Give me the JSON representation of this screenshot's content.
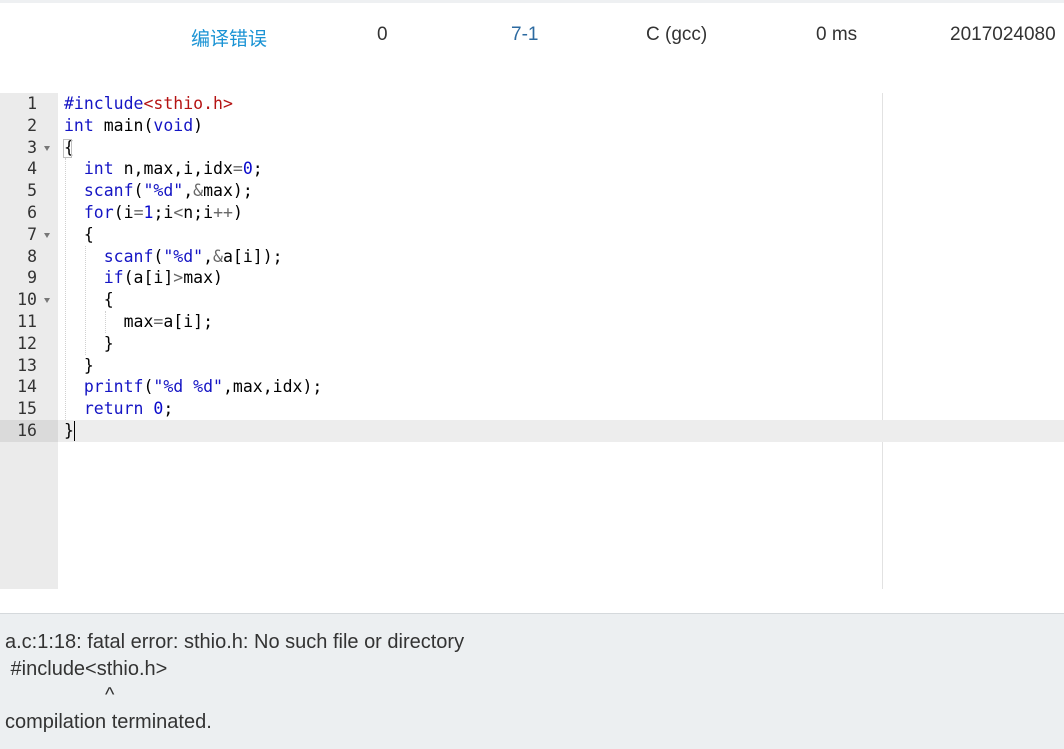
{
  "status_row": {
    "result": "编译错误",
    "score": "0",
    "problem": "7-1",
    "compiler": "C (gcc)",
    "time": "0 ms",
    "user": "2017024080"
  },
  "editor": {
    "line_numbers": [
      "1",
      "2",
      "3",
      "4",
      "5",
      "6",
      "7",
      "8",
      "9",
      "10",
      "11",
      "12",
      "13",
      "14",
      "15",
      "16"
    ],
    "fold_markers": [
      3,
      7,
      10
    ],
    "active_line": 16
  },
  "code": {
    "l1_hash": "#include",
    "l1_header": "<sthio.h>",
    "l2_int": "int",
    "l2_main": " main(",
    "l2_void": "void",
    "l2_close": ")",
    "l3": "{",
    "l4_int": "int",
    "l4_rest_a": " n,max,i,idx",
    "l4_eq": "=",
    "l4_zero": "0",
    "l4_end": ";",
    "l5_fn": "scanf",
    "l5_open": "(",
    "l5_str": "\"%d\"",
    "l5_comma": ",",
    "l5_amp": "&",
    "l5_rest": "max);",
    "l6_for": "for",
    "l6_a": "(i",
    "l6_eq": "=",
    "l6_one": "1",
    "l6_b": ";i",
    "l6_lt": "<",
    "l6_c": "n;i",
    "l6_pp": "++",
    "l6_d": ")",
    "l7": "{",
    "l8_fn": "scanf",
    "l8_open": "(",
    "l8_str": "\"%d\"",
    "l8_comma": ",",
    "l8_amp": "&",
    "l8_rest": "a[i]);",
    "l9_if": "if",
    "l9_a": "(a[i]",
    "l9_gt": ">",
    "l9_b": "max)",
    "l10": "{",
    "l11_a": "max",
    "l11_eq": "=",
    "l11_b": "a[i];",
    "l12": "}",
    "l13": "}",
    "l14_fn": "printf",
    "l14_open": "(",
    "l14_str": "\"%d %d\"",
    "l14_rest": ",max,idx);",
    "l15_ret": "return",
    "l15_sp": " ",
    "l15_zero": "0",
    "l15_end": ";",
    "l16": "}"
  },
  "output": {
    "lines": [
      "a.c:1:18: fatal error: sthio.h: No such file or directory",
      " #include<sthio.h>",
      "                  ^",
      "compilation terminated."
    ]
  }
}
